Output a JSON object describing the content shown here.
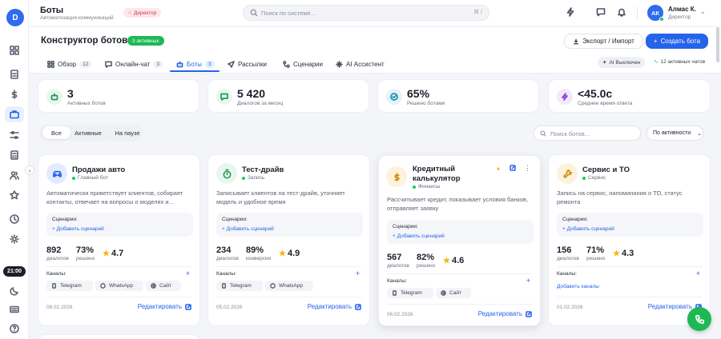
{
  "sidebar": {
    "logo": "D",
    "time": "21:00"
  },
  "topbar": {
    "title": "Боты",
    "subtitle": "Автоматизация коммуникаций",
    "role_badge": "Директор",
    "search_placeholder": "Поиск по системе...",
    "search_shortcut": "⌘ /",
    "user": {
      "initials": "АК",
      "name": "Алмас К.",
      "role": "Директор"
    }
  },
  "header": {
    "title": "Конструктор ботов",
    "active_badge": "3 активных",
    "export_label": "Экспорт / Импорт",
    "create_label": "Создать бота",
    "tabs": [
      {
        "label": "Обзор",
        "count": "12"
      },
      {
        "label": "Онлайн-чат",
        "count": "3"
      },
      {
        "label": "Боты",
        "count": "3"
      },
      {
        "label": "Рассылки",
        "count": ""
      },
      {
        "label": "Сценарии",
        "count": ""
      },
      {
        "label": "AI Ассистент",
        "count": ""
      }
    ],
    "ai_status": "AI Выключен",
    "active_chats": "12 активных чатов"
  },
  "stats": [
    {
      "value": "3",
      "label": "Активных ботов",
      "color": "#e9f6ee"
    },
    {
      "value": "5 420",
      "label": "Диалогов за месяц",
      "color": "#e9f6ee"
    },
    {
      "value": "65%",
      "label": "Решено ботами",
      "color": "#e4f3f7"
    },
    {
      "value": "<45.0с",
      "label": "Среднее время ответа",
      "color": "#f2e9fb"
    }
  ],
  "filters": {
    "chips": [
      "Все",
      "Активные",
      "На паузе"
    ],
    "search_placeholder": "Поиск ботов...",
    "sort": "По активности"
  },
  "bots": [
    {
      "name": "Продажи авто",
      "tag": "Главный бот",
      "desc": "Автоматически приветствует клиентов, собирает контакты, отвечает на вопросы о моделях и...",
      "scen_label": "Сценарии:",
      "scen_add": "+ Добавить сценарий",
      "m1_val": "892",
      "m1_lab": "диалогов",
      "m2_val": "73%",
      "m2_lab": "решено",
      "rating": "4.7",
      "ch_label": "Каналы:",
      "channels": [
        "Telegram",
        "WhatsApp",
        "Сайт"
      ],
      "date": "06.02.2026",
      "edit": "Редактировать"
    },
    {
      "name": "Тест-драйв",
      "tag": "Запись",
      "desc": "Записывает клиентов на тест-драйв, уточняет модель и удобное время",
      "scen_label": "Сценарии:",
      "scen_add": "+ Добавить сценарий",
      "m1_val": "234",
      "m1_lab": "диалогов",
      "m2_val": "89%",
      "m2_lab": "конверсия",
      "rating": "4.9",
      "ch_label": "Каналы:",
      "channels": [
        "Telegram",
        "WhatsApp"
      ],
      "date": "05.02.2026",
      "edit": "Редактировать"
    },
    {
      "name": "Кредитный калькулятор",
      "tag": "Финансы",
      "desc": "Рассчитывает кредит, показывает условия банков, отправляет заявку",
      "scen_label": "Сценарии:",
      "scen_add": "+ Добавить сценарий",
      "m1_val": "567",
      "m1_lab": "диалогов",
      "m2_val": "82%",
      "m2_lab": "решено",
      "rating": "4.6",
      "ch_label": "Каналы:",
      "channels": [
        "Telegram",
        "Сайт"
      ],
      "date": "06.02.2026",
      "edit": "Редактировать"
    },
    {
      "name": "Сервис и ТО",
      "tag": "Сервис",
      "desc": "Запись на сервис, напоминания о ТО, статус ремонта",
      "scen_label": "Сценарии:",
      "scen_add": "+ Добавить сценарий",
      "m1_val": "156",
      "m1_lab": "диалогов",
      "m2_val": "71%",
      "m2_lab": "решено",
      "rating": "4.3",
      "ch_label": "Каналы:",
      "channels": [],
      "add_channels": "Добавить каналы",
      "date": "01.02.2026",
      "edit": "Редактировать"
    }
  ]
}
